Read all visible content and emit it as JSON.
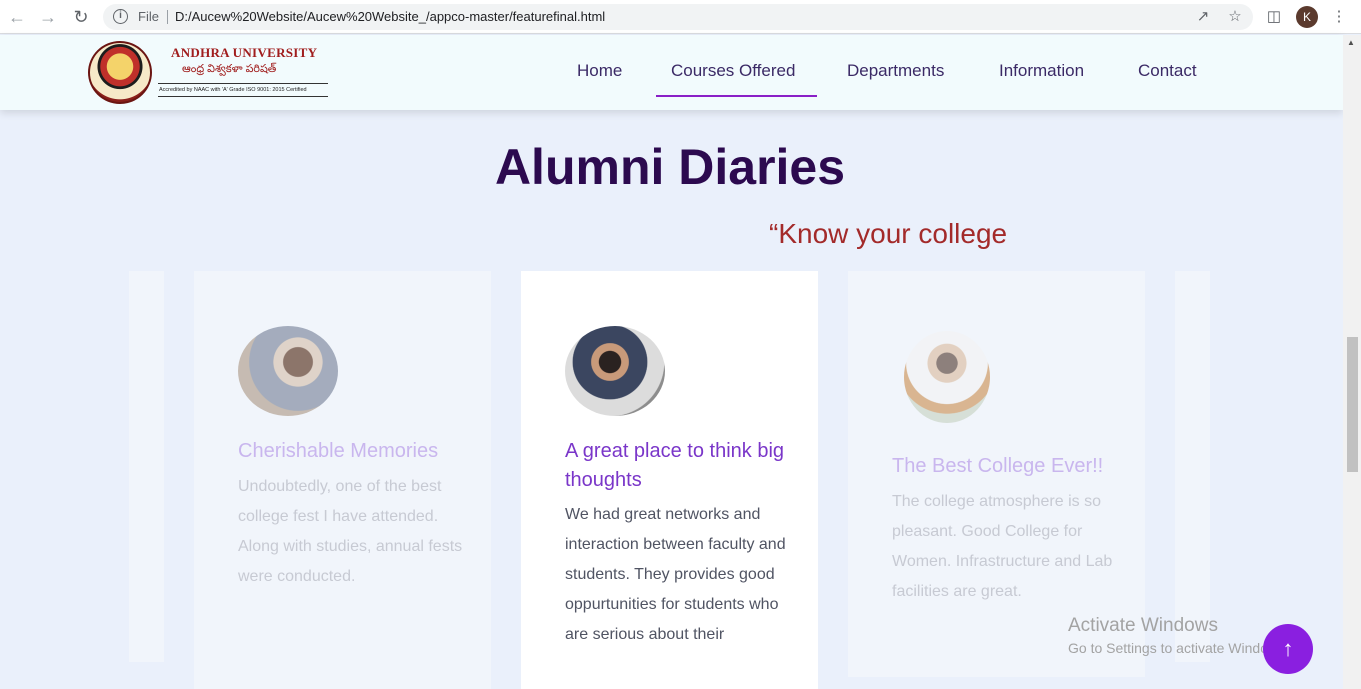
{
  "browser": {
    "back_icon": "arrow-left-icon",
    "forward_icon": "arrow-right-icon",
    "reload_icon": "reload-icon",
    "file_label": "File",
    "url": "D:/Aucew%20Website/Aucew%20Website_/appco-master/featurefinal.html",
    "profile_initial": "K"
  },
  "header": {
    "logo_title": "ANDHRA UNIVERSITY",
    "logo_telugu": "ఆంధ్ర విశ్వకళా పరిషత్",
    "logo_accreditation": "Accredited by NAAC with 'A' Grade ISO 9001: 2015 Certified",
    "nav": [
      "Home",
      "Courses Offered",
      "Departments",
      "Information",
      "Contact"
    ],
    "active_nav": "Courses Offered"
  },
  "main": {
    "title": "Alumni Diaries",
    "tagline": "“Know your college"
  },
  "cards": [
    {
      "title": "Cherishable Memories",
      "body": "Undoubtedly, one of the best college fest I have attended. Along with studies, annual fests were conducted."
    },
    {
      "title": "A great place to think big thoughts",
      "body": "We had great networks and interaction between faculty and students. They provides good oppurtunities for students who are serious about their"
    },
    {
      "title": "The Best College Ever!!",
      "body": "The college atmosphere is so pleasant. Good College for Women. Infrastructure and Lab facilities are great."
    }
  ],
  "watermark": {
    "title": "Activate Windows",
    "subtitle": "Go to Settings to activate Windows."
  },
  "colors": {
    "accent": "#8a1fe0",
    "title": "#2c0a4f",
    "tagline": "#a32a2a",
    "nav_text": "#3b2a66"
  }
}
